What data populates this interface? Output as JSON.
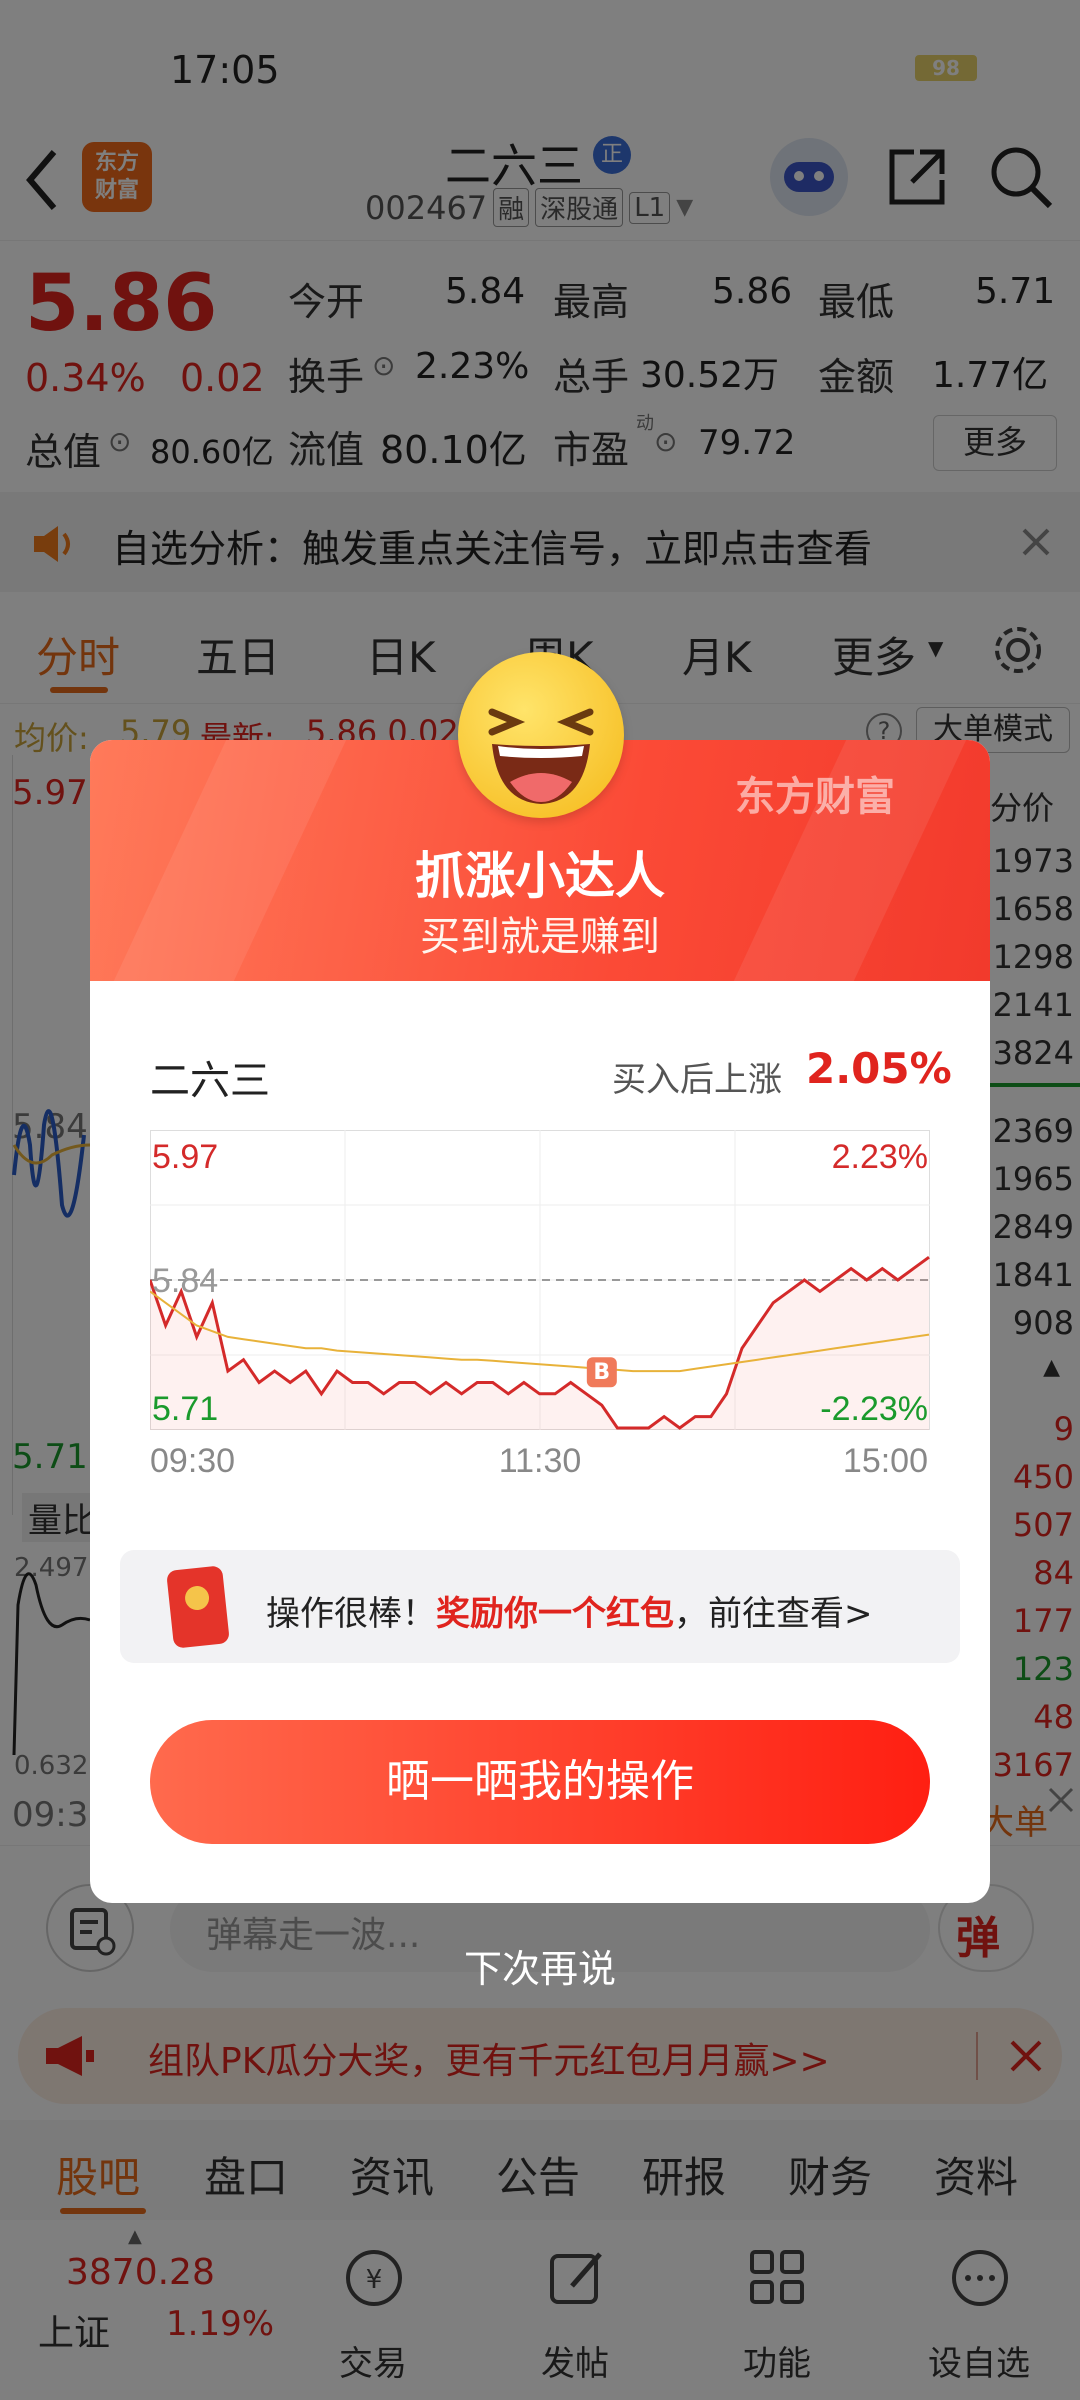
{
  "status_bar": {
    "time": "17:05",
    "battery": "98"
  },
  "header": {
    "logo_line1": "东方",
    "logo_line2": "财富",
    "stock_name": "二六三",
    "badge": "正",
    "code": "002467",
    "tags": [
      "融",
      "深股通",
      "L1"
    ]
  },
  "quote": {
    "price": "5.86",
    "change_pct": "0.34%",
    "change": "0.02",
    "total_value_label": "总值",
    "total_value": "80.60亿",
    "fields": [
      {
        "label": "今开",
        "value": "5.84"
      },
      {
        "label": "最高",
        "value": "5.86"
      },
      {
        "label": "最低",
        "value": "5.71"
      },
      {
        "label": "换手",
        "value": "2.23%"
      },
      {
        "label": "总手",
        "value": "30.52万"
      },
      {
        "label": "金额",
        "value": "1.77亿"
      },
      {
        "label": "流值",
        "value": "80.10亿"
      },
      {
        "label": "市盈",
        "value": "79.72"
      }
    ],
    "pe_sup": "动",
    "more_button": "更多"
  },
  "notice": {
    "text": "自选分析：触发重点关注信号，立即点击查看"
  },
  "chart_tabs": [
    "分时",
    "五日",
    "日K",
    "周K",
    "月K",
    "更多"
  ],
  "chart_info": {
    "avg_label": "均价:",
    "avg_value": "5.79",
    "last_label": "最新:",
    "last_value": "5.86 0.02",
    "mode_button": "大单模式"
  },
  "background_chart": {
    "top_left": "5.97",
    "mid_left": "5.84",
    "bottom_left": "5.71",
    "volume_label": "量比",
    "vol_top": "2.497",
    "vol_bottom": "0.632",
    "time_left": "09:3",
    "right_header": "分价",
    "right_numbers_top": [
      "1973",
      "1658",
      "1298",
      "2141",
      "3824"
    ],
    "right_numbers_mid": [
      "2369",
      "1965",
      "2849",
      "1841",
      "908"
    ],
    "right_numbers_low": [
      "9",
      "450",
      "507",
      "84",
      "177",
      "123",
      "48",
      "3167"
    ],
    "right_numbers_low_colors": [
      "red",
      "red",
      "red",
      "red",
      "red",
      "green",
      "red",
      "red"
    ],
    "big_order_tag": "大单"
  },
  "danmu": {
    "placeholder": "弹幕走一波...",
    "button": "弹"
  },
  "promo": {
    "text": "组队PK瓜分大奖，更有千元红包月月赢>>"
  },
  "bottom_tabs": [
    "股吧",
    "盘口",
    "资讯",
    "公告",
    "研报",
    "财务",
    "资料"
  ],
  "bottom_nav": {
    "index_value": "3870.28",
    "index_name": "上证",
    "index_change": "1.19%",
    "items": [
      "交易",
      "发帖",
      "功能",
      "设自选"
    ]
  },
  "modal": {
    "brand": "东方财富",
    "title": "抓涨小达人",
    "subtitle": "买到就是赚到",
    "stock_name": "二六三",
    "gain_label": "买入后上涨",
    "gain_value": "2.05%",
    "buy_marker": "B",
    "reward_text_a": "操作很棒！",
    "reward_text_b": "奖励你一个红包",
    "reward_text_c": "，前往查看>",
    "share_button": "晒一晒我的操作",
    "dismiss": "下次再说"
  },
  "chart_data": {
    "type": "line",
    "y_labels_left": [
      "5.97",
      "5.84",
      "5.71"
    ],
    "y_labels_right": [
      "2.23%",
      "-2.23%"
    ],
    "x_labels": [
      "09:30",
      "11:30",
      "15:00"
    ],
    "ylim": [
      5.71,
      5.97
    ],
    "prev_close": 5.84,
    "series": [
      {
        "name": "",
        "color": "#d42a2a",
        "values": [
          5.84,
          5.8,
          5.83,
          5.79,
          5.82,
          5.76,
          5.77,
          5.75,
          5.76,
          5.75,
          5.76,
          5.74,
          5.76,
          5.75,
          5.75,
          5.74,
          5.75,
          5.75,
          5.74,
          5.75,
          5.74,
          5.75,
          5.75,
          5.74,
          5.75,
          5.74,
          5.74,
          5.75,
          5.74,
          5.73,
          5.71,
          5.71,
          5.71,
          5.72,
          5.71,
          5.72,
          5.72,
          5.74,
          5.78,
          5.8,
          5.82,
          5.83,
          5.84,
          5.83,
          5.84,
          5.85,
          5.84,
          5.85,
          5.84,
          5.85,
          5.86
        ]
      },
      {
        "name": "",
        "color": "#e8b23a",
        "values": [
          5.83,
          5.82,
          5.81,
          5.8,
          5.795,
          5.79,
          5.788,
          5.786,
          5.784,
          5.782,
          5.78,
          5.78,
          5.778,
          5.777,
          5.776,
          5.775,
          5.774,
          5.773,
          5.772,
          5.771,
          5.77,
          5.77,
          5.769,
          5.768,
          5.767,
          5.766,
          5.765,
          5.764,
          5.763,
          5.762,
          5.761,
          5.76,
          5.76,
          5.76,
          5.76,
          5.762,
          5.764,
          5.766,
          5.768,
          5.77,
          5.772,
          5.774,
          5.776,
          5.778,
          5.78,
          5.782,
          5.784,
          5.786,
          5.788,
          5.79,
          5.792
        ]
      }
    ],
    "buy_index": 29,
    "grid": true
  }
}
